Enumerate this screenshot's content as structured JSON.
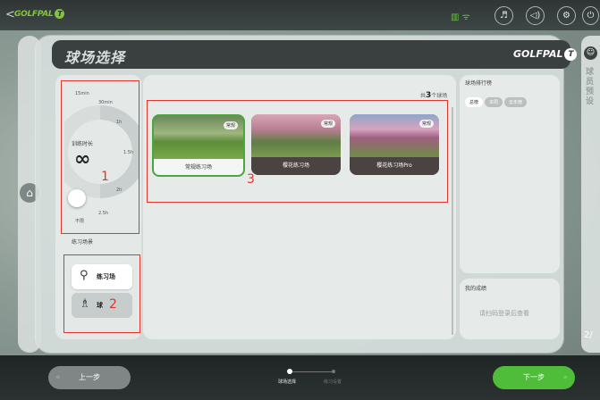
{
  "topbar": {
    "back_glyph": "<",
    "logo_text": "GOLFPAL",
    "logo_badge": "T",
    "status_glyphs": "▥ ᯤ",
    "icons": [
      "music-icon",
      "volume-icon",
      "settings-icon",
      "power-icon"
    ],
    "icon_glyphs": [
      "♬",
      "◁)",
      "⚙",
      "⏻"
    ]
  },
  "header": {
    "title": "球场选择",
    "brand": "GOLFPAL",
    "brand_badge": "T"
  },
  "side": {
    "right_tab_label": "球员预设",
    "right_page": "2/"
  },
  "timer": {
    "label": "训练时长",
    "value": "∞",
    "ticks": [
      "15min",
      "30min",
      "1h",
      "1.5h",
      "2h",
      "2.5h",
      "不限"
    ]
  },
  "scene": {
    "label": "练习场景",
    "options": [
      {
        "label": "练习场",
        "icon": "golf-ball-tee-icon",
        "glyph": "⚲",
        "selected": true
      },
      {
        "label": "球",
        "icon": "golfer-icon",
        "glyph": "♗",
        "selected": false
      }
    ]
  },
  "courses": {
    "count_prefix": "共",
    "count": "3",
    "count_suffix": "个球场",
    "items": [
      {
        "name": "常规练习场",
        "badge": "常规",
        "selected": true
      },
      {
        "name": "樱花练习场",
        "badge": "常规",
        "selected": false
      },
      {
        "name": "樱花练习场Pro",
        "badge": "常规",
        "selected": false
      }
    ]
  },
  "ranking": {
    "title": "球场排行榜",
    "tabs": [
      "总榜",
      "本周",
      "去年榜"
    ]
  },
  "my_score": {
    "title": "我的成绩",
    "hint": "请扫码登录后查看"
  },
  "annotations": [
    "1",
    "2",
    "3"
  ],
  "footer": {
    "prev_label": "上一步",
    "next_label": "下一步",
    "prev_glyph": "«",
    "next_glyph": "»",
    "steps": [
      "球场选择",
      "练习设置"
    ]
  },
  "colors": {
    "accent_green": "#4fbd3a",
    "annotation_red": "#e0352c",
    "dark_bar": "#39403f"
  }
}
